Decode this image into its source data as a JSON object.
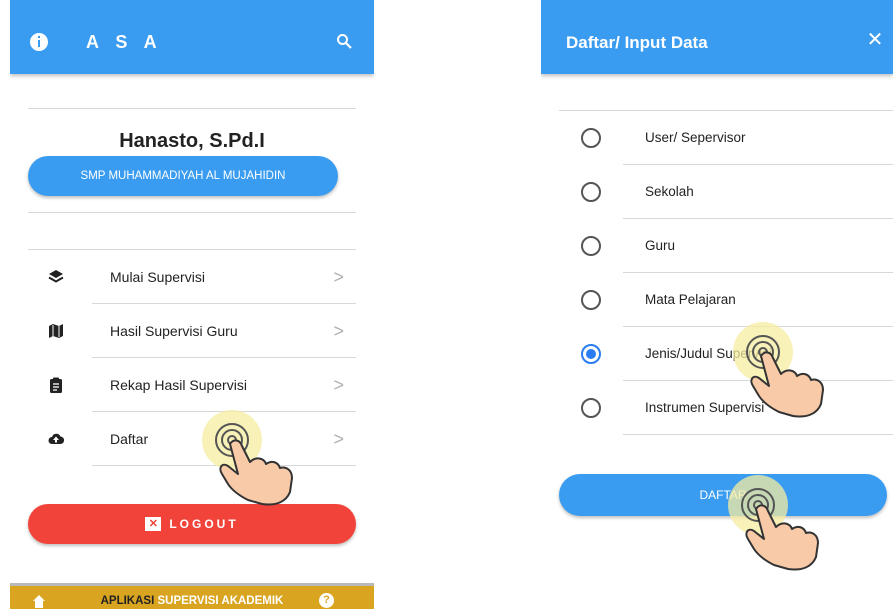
{
  "left": {
    "appbar": {
      "title": "A S A"
    },
    "profile": {
      "name": "Hanasto, S.Pd.I",
      "school": "SMP MUHAMMADIYAH AL MUJAHIDIN"
    },
    "menu": [
      {
        "label": "Mulai Supervisi",
        "icon": "layers-icon"
      },
      {
        "label": "Hasil Supervisi Guru",
        "icon": "map-icon"
      },
      {
        "label": "Rekap Hasil Supervisi",
        "icon": "clipboard-icon"
      },
      {
        "label": "Daftar",
        "icon": "cloud-upload-icon"
      }
    ],
    "chevron": ">",
    "logout": {
      "label": "LOGOUT"
    },
    "bottombar": {
      "prefix": "APLIKASI",
      "highlight": "SUPERVISI AKADEMIK"
    }
  },
  "right": {
    "appbar": {
      "title": "Daftar/ Input Data",
      "close": "✕"
    },
    "options": [
      {
        "label": "User/ Sepervisor",
        "selected": false
      },
      {
        "label": "Sekolah",
        "selected": false
      },
      {
        "label": "Guru",
        "selected": false
      },
      {
        "label": "Mata Pelajaran",
        "selected": false
      },
      {
        "label": "Jenis/Judul Supervisi",
        "selected": true
      },
      {
        "label": "Instrumen Supervisi",
        "selected": false
      }
    ],
    "submit": {
      "label": "DAFTAR"
    }
  },
  "colors": {
    "primary": "#3a9cf0",
    "logout": "#f2433a",
    "bottombar": "#d9a521",
    "radio_selected": "#2a7df0"
  }
}
